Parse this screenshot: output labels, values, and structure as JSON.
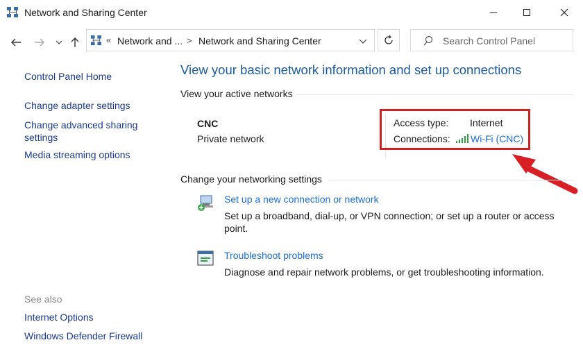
{
  "window": {
    "title": "Network and Sharing Center"
  },
  "address": {
    "crumb1": "Network and ...",
    "crumb2": "Network and Sharing Center",
    "overflow": "«",
    "separator": ">"
  },
  "search": {
    "placeholder": "Search Control Panel"
  },
  "left_pane": {
    "home": "Control Panel Home",
    "links": [
      "Change adapter settings",
      "Change advanced sharing settings",
      "Media streaming options"
    ],
    "see_also_heading": "See also",
    "see_also": [
      "Internet Options",
      "Windows Defender Firewall"
    ]
  },
  "main": {
    "heading": "View your basic network information and set up connections",
    "active_heading": "View your active networks",
    "network": {
      "name": "CNC",
      "category": "Private network",
      "access_label": "Access type:",
      "access_value": "Internet",
      "connections_label": "Connections:",
      "connection_link": "Wi-Fi (CNC)"
    },
    "change_heading": "Change your networking settings",
    "tasks": [
      {
        "title": "Set up a new connection or network",
        "description": "Set up a broadband, dial-up, or VPN connection; or set up a router or access point."
      },
      {
        "title": "Troubleshoot problems",
        "description": "Diagnose and repair network problems, or get troubleshooting information."
      }
    ]
  },
  "icons": {
    "title": "network-sharing-icon",
    "back": "arrow-left-icon",
    "forward": "arrow-right-icon",
    "recent": "chevron-down-icon",
    "up": "arrow-up-icon",
    "refresh": "refresh-icon",
    "search": "search-icon",
    "wifi": "wifi-signal-icon"
  },
  "colors": {
    "link": "#1a6fd0",
    "heading": "#1a5a9e",
    "highlight": "#cc2222"
  }
}
